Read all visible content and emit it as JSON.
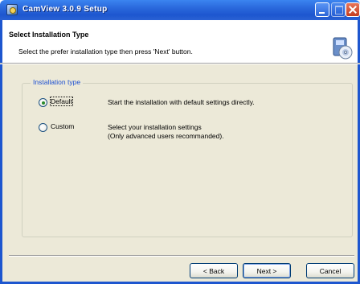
{
  "window": {
    "title": "CamView 3.0.9 Setup"
  },
  "header": {
    "title": "Select Installation Type",
    "subtitle": "Select the prefer installation type then press 'Next' button.",
    "icon": "setup-disc-icon"
  },
  "group": {
    "legend": "Installation type",
    "options": [
      {
        "label": "Default",
        "checked": true,
        "description_lines": [
          "Start the installation with default settings directly."
        ]
      },
      {
        "label": "Custom",
        "checked": false,
        "description_lines": [
          "Select your installation settings",
          "(Only advanced users recommanded)."
        ]
      }
    ]
  },
  "buttons": {
    "back": "< Back",
    "next": "Next >",
    "cancel": "Cancel"
  },
  "colors": {
    "titlebar": "#2a68dc",
    "body": "#ece9d8",
    "legend": "#1c4fd1"
  }
}
